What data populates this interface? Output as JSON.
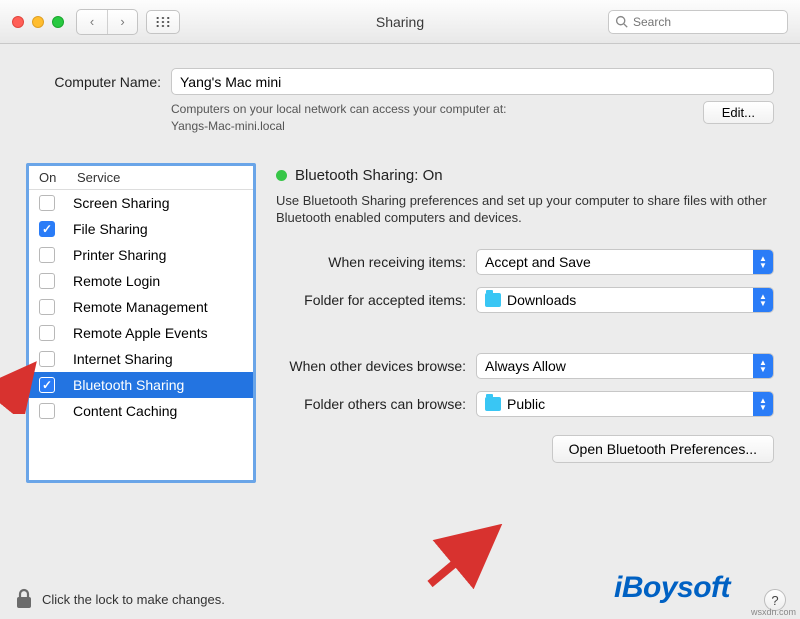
{
  "window": {
    "title": "Sharing"
  },
  "search": {
    "placeholder": "Search"
  },
  "computer_name": {
    "label": "Computer Name:",
    "value": "Yang's Mac mini",
    "help_line1": "Computers on your local network can access your computer at:",
    "help_line2": "Yangs-Mac-mini.local",
    "edit_label": "Edit..."
  },
  "services": {
    "header_on": "On",
    "header_service": "Service",
    "items": [
      {
        "label": "Screen Sharing",
        "checked": false,
        "selected": false
      },
      {
        "label": "File Sharing",
        "checked": true,
        "selected": false
      },
      {
        "label": "Printer Sharing",
        "checked": false,
        "selected": false
      },
      {
        "label": "Remote Login",
        "checked": false,
        "selected": false
      },
      {
        "label": "Remote Management",
        "checked": false,
        "selected": false
      },
      {
        "label": "Remote Apple Events",
        "checked": false,
        "selected": false
      },
      {
        "label": "Internet Sharing",
        "checked": false,
        "selected": false
      },
      {
        "label": "Bluetooth Sharing",
        "checked": true,
        "selected": true
      },
      {
        "label": "Content Caching",
        "checked": false,
        "selected": false
      }
    ]
  },
  "detail": {
    "status_title": "Bluetooth Sharing: On",
    "status_color": "#37c648",
    "description": "Use Bluetooth Sharing preferences and set up your computer to share files with other Bluetooth enabled computers and devices.",
    "rows": {
      "receiving_label": "When receiving items:",
      "receiving_value": "Accept and Save",
      "accepted_folder_label": "Folder for accepted items:",
      "accepted_folder_value": "Downloads",
      "browse_label": "When other devices browse:",
      "browse_value": "Always Allow",
      "browse_folder_label": "Folder others can browse:",
      "browse_folder_value": "Public"
    },
    "open_btn": "Open Bluetooth Preferences..."
  },
  "footer": {
    "lock_text": "Click the lock to make changes."
  },
  "brand": "iBoysoft",
  "watermark": "wsxdn.com"
}
